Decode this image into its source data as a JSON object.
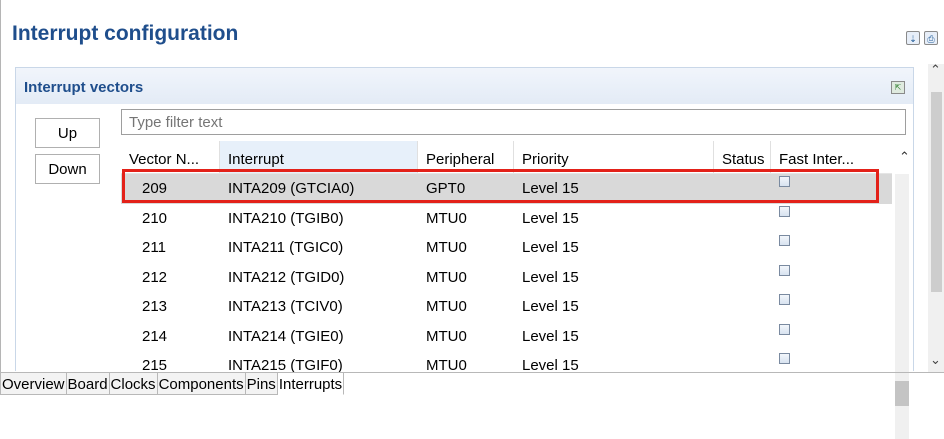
{
  "page": {
    "title": "Interrupt configuration"
  },
  "header_icons": [
    "generate-code-icon",
    "print-icon"
  ],
  "section": {
    "title": "Interrupt vectors",
    "header_icon": "collapse-icon"
  },
  "buttons": {
    "up": "Up",
    "down": "Down"
  },
  "filter": {
    "placeholder": "Type filter text",
    "value": ""
  },
  "table": {
    "columns": [
      "Vector N...",
      "Interrupt",
      "Peripheral",
      "Priority",
      "Status",
      "Fast Inter..."
    ],
    "sorted_column": "Interrupt",
    "rows": [
      {
        "vector": "209",
        "interrupt": "INTA209 (GTCIA0)",
        "peripheral": "GPT0",
        "priority": "Level 15",
        "status": "",
        "fast": false,
        "selected": true
      },
      {
        "vector": "210",
        "interrupt": "INTA210 (TGIB0)",
        "peripheral": "MTU0",
        "priority": "Level 15",
        "status": "",
        "fast": false
      },
      {
        "vector": "211",
        "interrupt": "INTA211 (TGIC0)",
        "peripheral": "MTU0",
        "priority": "Level 15",
        "status": "",
        "fast": false
      },
      {
        "vector": "212",
        "interrupt": "INTA212 (TGID0)",
        "peripheral": "MTU0",
        "priority": "Level 15",
        "status": "",
        "fast": false
      },
      {
        "vector": "213",
        "interrupt": "INTA213 (TCIV0)",
        "peripheral": "MTU0",
        "priority": "Level 15",
        "status": "",
        "fast": false
      },
      {
        "vector": "214",
        "interrupt": "INTA214 (TGIE0)",
        "peripheral": "MTU0",
        "priority": "Level 15",
        "status": "",
        "fast": false
      },
      {
        "vector": "215",
        "interrupt": "INTA215 (TGIF0)",
        "peripheral": "MTU0",
        "priority": "Level 15",
        "status": "",
        "fast": false
      }
    ]
  },
  "highlight": {
    "color": "#e32119"
  },
  "tabs": [
    "Overview",
    "Board",
    "Clocks",
    "Components",
    "Pins",
    "Interrupts"
  ],
  "active_tab": "Interrupts"
}
